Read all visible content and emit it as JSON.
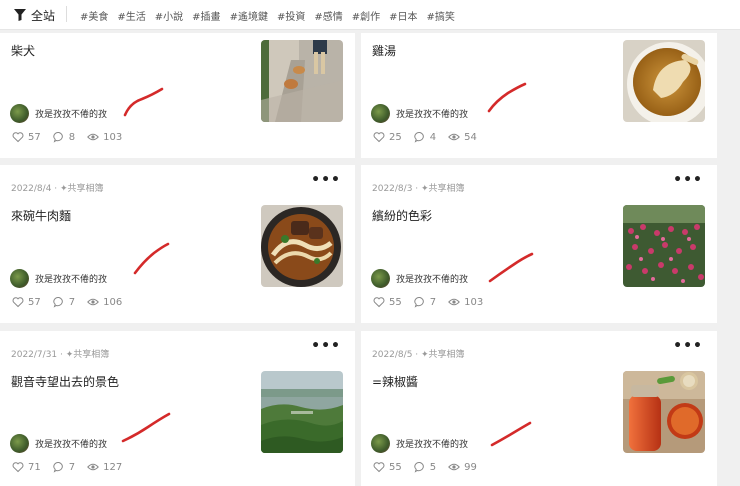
{
  "topbar": {
    "filter_label": "全站",
    "tags": [
      "#美食",
      "#生活",
      "#小說",
      "#插畫",
      "#遙境鍵",
      "#投資",
      "#感情",
      "#創作",
      "#日本",
      "#搞笑"
    ]
  },
  "colors": {
    "mark": "#d42a2a",
    "accent": "#222222",
    "muted": "#999999"
  },
  "cards": [
    {
      "date": "",
      "share": "",
      "title": "柴犬",
      "author": "孜是孜孜不倦的孜",
      "likes": "57",
      "comments": "8",
      "views": "103",
      "image": "shiba-walk-photo"
    },
    {
      "date": "",
      "share": "",
      "title": "雞湯",
      "author": "孜是孜孜不倦的孜",
      "likes": "25",
      "comments": "4",
      "views": "54",
      "image": "chicken-soup-photo"
    },
    {
      "date": "2022/8/4",
      "share": "✦共享相簿",
      "title": "來碗牛肉麵",
      "author": "孜是孜孜不倦的孜",
      "likes": "57",
      "comments": "7",
      "views": "106",
      "image": "beef-noodle-photo"
    },
    {
      "date": "2022/8/3",
      "share": "✦共享相簿",
      "title": "繽紛的色彩",
      "author": "孜是孜孜不倦的孜",
      "likes": "55",
      "comments": "7",
      "views": "103",
      "image": "flower-field-photo"
    },
    {
      "date": "2022/7/31",
      "share": "✦共享相簿",
      "title": "觀音寺望出去的景色",
      "author": "孜是孜孜不倦的孜",
      "likes": "71",
      "comments": "7",
      "views": "127",
      "image": "landscape-photo"
    },
    {
      "date": "2022/8/5",
      "share": "✦共享相簿",
      "title": "=辣椒醬",
      "author": "孜是孜孜不倦的孜",
      "likes": "55",
      "comments": "5",
      "views": "99",
      "image": "chili-sauce-photo"
    }
  ],
  "more_label": "•••"
}
